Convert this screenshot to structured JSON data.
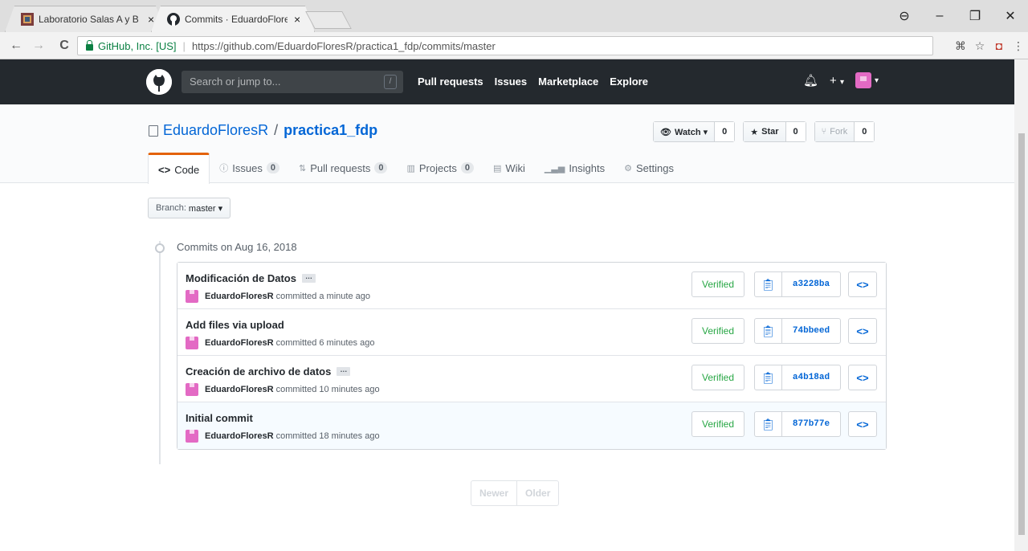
{
  "browser": {
    "tabs": [
      {
        "title": "Laboratorio Salas A y B",
        "close": "×"
      },
      {
        "title": "Commits · EduardoFlores",
        "close": "×"
      }
    ],
    "window_controls": [
      "⊖",
      "–",
      "❐",
      "✕"
    ],
    "nav": {
      "back": "←",
      "forward": "→",
      "reload": "C"
    },
    "secure_label": "GitHub, Inc. [US]",
    "url": "https://github.com/EduardoFloresR/practica1_fdp/commits/master"
  },
  "header": {
    "search_placeholder": "Search or jump to...",
    "search_key": "/",
    "nav": [
      "Pull requests",
      "Issues",
      "Marketplace",
      "Explore"
    ],
    "plus": "+",
    "caret": "▾"
  },
  "repo": {
    "owner": "EduardoFloresR",
    "slash": "/",
    "name": "practica1_fdp",
    "watch_label": "Watch ▾",
    "watch_count": "0",
    "star_label": "Star",
    "star_count": "0",
    "fork_label": "Fork",
    "fork_count": "0"
  },
  "tabs": {
    "code": "Code",
    "issues": "Issues",
    "issues_count": "0",
    "pulls": "Pull requests",
    "pulls_count": "0",
    "projects": "Projects",
    "projects_count": "0",
    "wiki": "Wiki",
    "insights": "Insights",
    "settings": "Settings"
  },
  "branch": {
    "prefix": "Branch:",
    "name": "master ▾"
  },
  "commit_group": {
    "title": "Commits on Aug 16, 2018"
  },
  "commits": [
    {
      "message": "Modificación de Datos",
      "has_ellipsis": true,
      "author": "EduardoFloresR",
      "time": "committed a minute ago",
      "verified": "Verified",
      "sha": "a3228ba",
      "browse": "<>"
    },
    {
      "message": "Add files via upload",
      "has_ellipsis": false,
      "author": "EduardoFloresR",
      "time": "committed 6 minutes ago",
      "verified": "Verified",
      "sha": "74bbeed",
      "browse": "<>"
    },
    {
      "message": "Creación de archivo de datos",
      "has_ellipsis": true,
      "author": "EduardoFloresR",
      "time": "committed 10 minutes ago",
      "verified": "Verified",
      "sha": "a4b18ad",
      "browse": "<>"
    },
    {
      "message": "Initial commit",
      "has_ellipsis": false,
      "author": "EduardoFloresR",
      "time": "committed 18 minutes ago",
      "verified": "Verified",
      "sha": "877b77e",
      "browse": "<>"
    }
  ],
  "pagination": {
    "newer": "Newer",
    "older": "Older"
  },
  "ellipsis_label": "…"
}
